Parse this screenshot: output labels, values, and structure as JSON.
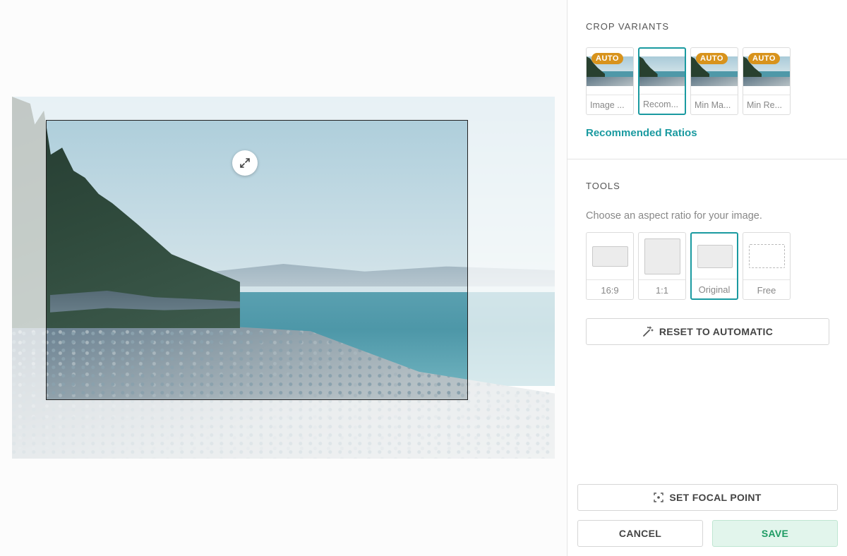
{
  "crop_variants": {
    "title": "CROP VARIANTS",
    "items": [
      {
        "label": "Image ...",
        "auto": true,
        "selected": false
      },
      {
        "label": "Recom...",
        "auto": false,
        "selected": true
      },
      {
        "label": "Min Ma...",
        "auto": true,
        "selected": false
      },
      {
        "label": "Min Re...",
        "auto": true,
        "selected": false
      }
    ],
    "auto_badge": "AUTO",
    "link": "Recommended Ratios"
  },
  "tools": {
    "title": "TOOLS",
    "hint": "Choose an aspect ratio for your image.",
    "ratios": [
      {
        "label": "16:9",
        "selected": false
      },
      {
        "label": "1:1",
        "selected": false
      },
      {
        "label": "Original",
        "selected": true
      },
      {
        "label": "Free",
        "selected": false
      }
    ],
    "reset_label": "RESET TO AUTOMATIC"
  },
  "actions": {
    "focal_point_label": "SET FOCAL POINT",
    "cancel_label": "CANCEL",
    "save_label": "SAVE"
  },
  "colors": {
    "accent": "#1a9aa0",
    "auto_badge": "#d8931c",
    "save_text": "#1e9b63"
  }
}
